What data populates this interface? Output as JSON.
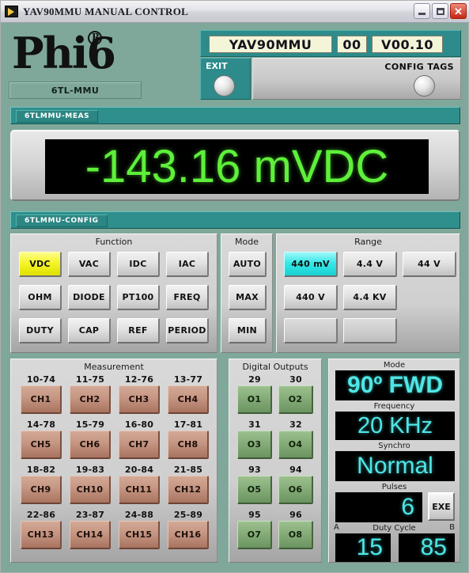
{
  "window": {
    "title": "YAV90MMU MANUAL CONTROL",
    "icon": "app-icon",
    "minimize_label": "",
    "maximize_label": "",
    "close_label": "✕"
  },
  "branding": {
    "logo_text": "Phi6",
    "logo_mark": "R",
    "subtitle": "6TL-MMU"
  },
  "header": {
    "device_name": "YAV90MMU",
    "device_number": "00",
    "firmware_version": "V00.10",
    "exit_label": "EXIT",
    "config_tags_label": "CONFIG TAGS"
  },
  "measure_section": {
    "header": "6TLMMU-MEAS",
    "reading": "-143.16 mVDC",
    "lcd_color": "#5ef03a"
  },
  "config_section": {
    "header": "6TLMMU-CONFIG",
    "function": {
      "title": "Function",
      "buttons": [
        {
          "label": "VDC",
          "state": "selected"
        },
        {
          "label": "VAC",
          "state": "normal"
        },
        {
          "label": "IDC",
          "state": "normal"
        },
        {
          "label": "IAC",
          "state": "normal"
        },
        {
          "label": "OHM",
          "state": "normal"
        },
        {
          "label": "DIODE",
          "state": "normal"
        },
        {
          "label": "PT100",
          "state": "normal"
        },
        {
          "label": "FREQ",
          "state": "normal"
        },
        {
          "label": "DUTY",
          "state": "normal"
        },
        {
          "label": "CAP",
          "state": "normal"
        },
        {
          "label": "REF",
          "state": "normal"
        },
        {
          "label": "PERIOD",
          "state": "normal"
        }
      ],
      "selected_color": "#f5f52b"
    },
    "mode": {
      "title": "Mode",
      "buttons": [
        {
          "label": "AUTO",
          "state": "normal"
        },
        {
          "label": "MAX",
          "state": "normal"
        },
        {
          "label": "MIN",
          "state": "normal"
        }
      ]
    },
    "range": {
      "title": "Range",
      "buttons": [
        {
          "label": "440 mV",
          "state": "selected"
        },
        {
          "label": "4.4 V",
          "state": "normal"
        },
        {
          "label": "44 V",
          "state": "normal"
        },
        {
          "label": "440 V",
          "state": "normal"
        },
        {
          "label": "4.4 KV",
          "state": "normal"
        },
        {
          "label": "",
          "state": "blank"
        },
        {
          "label": "",
          "state": "empty"
        },
        {
          "label": "",
          "state": "empty"
        },
        {
          "label": "",
          "state": "blank"
        }
      ],
      "selected_color": "#38e8e8"
    }
  },
  "measurement_panel": {
    "title": "Measurement",
    "channels": [
      {
        "terminals": "10-74",
        "label": "CH1"
      },
      {
        "terminals": "11-75",
        "label": "CH2"
      },
      {
        "terminals": "12-76",
        "label": "CH3"
      },
      {
        "terminals": "13-77",
        "label": "CH4"
      },
      {
        "terminals": "14-78",
        "label": "CH5"
      },
      {
        "terminals": "15-79",
        "label": "CH6"
      },
      {
        "terminals": "16-80",
        "label": "CH7"
      },
      {
        "terminals": "17-81",
        "label": "CH8"
      },
      {
        "terminals": "18-82",
        "label": "CH9"
      },
      {
        "terminals": "19-83",
        "label": "CH10"
      },
      {
        "terminals": "20-84",
        "label": "CH11"
      },
      {
        "terminals": "21-85",
        "label": "CH12"
      },
      {
        "terminals": "22-86",
        "label": "CH13"
      },
      {
        "terminals": "23-87",
        "label": "CH14"
      },
      {
        "terminals": "24-88",
        "label": "CH15"
      },
      {
        "terminals": "25-89",
        "label": "CH16"
      }
    ],
    "button_color": "#c59683"
  },
  "digital_outputs": {
    "title": "Digital Outputs",
    "outputs": [
      {
        "terminal": "29",
        "label": "O1"
      },
      {
        "terminal": "30",
        "label": "O2"
      },
      {
        "terminal": "31",
        "label": "O3"
      },
      {
        "terminal": "32",
        "label": "O4"
      },
      {
        "terminal": "93",
        "label": "O5"
      },
      {
        "terminal": "94",
        "label": "O6"
      },
      {
        "terminal": "95",
        "label": "O7"
      },
      {
        "terminal": "96",
        "label": "O8"
      }
    ],
    "button_color": "#86ad79"
  },
  "status_panel": {
    "mode_label": "Mode",
    "mode_value": "90º FWD",
    "frequency_label": "Frequency",
    "frequency_value": "20 KHz",
    "synchro_label": "Synchro",
    "synchro_value": "Normal",
    "pulses_label": "Pulses",
    "pulses_value": "6",
    "exe_label": "EXE",
    "duty_cycle_label": "Duty Cycle",
    "duty_a_label": "A",
    "duty_b_label": "B",
    "duty_a_value": "15",
    "duty_b_value": "85",
    "lcd_color": "#4fe6e6"
  }
}
